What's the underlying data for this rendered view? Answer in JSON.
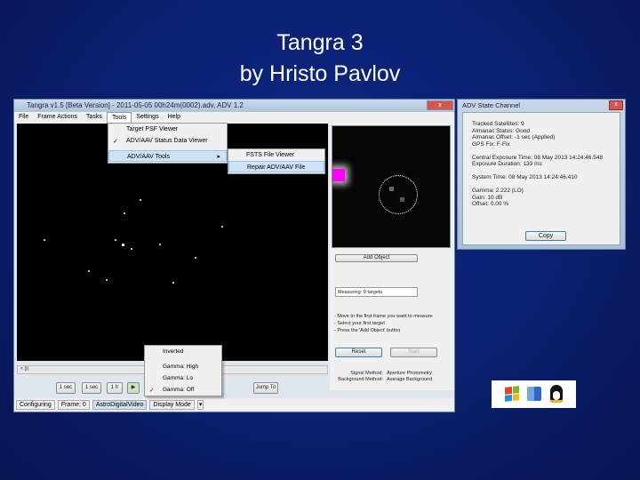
{
  "slide": {
    "title_line1": "Tangra 3",
    "title_line2": "by Hristo Pavlov"
  },
  "window": {
    "title": "Tangra v1.5 [Beta Version] - 2011-05-05 00h24m(0002).adv, ADV 1.2",
    "menu": [
      "File",
      "Frame Actions",
      "Tasks",
      "Tools",
      "Settings",
      "Help"
    ],
    "tools_menu": [
      {
        "label": "Target PSF Viewer",
        "checked": false
      },
      {
        "label": "ADV/AAV Status Data Viewer",
        "checked": true
      },
      {
        "label": "ADV/AAV Tools",
        "submenu": true
      }
    ],
    "submenu": [
      "FSTS File Viewer",
      "Repair ADV/AAV File"
    ],
    "right_panel": {
      "add_object": "Add Object",
      "measuring_label": "Measuring:",
      "measuring_value": "0 targets",
      "instructions": [
        "- Move to the first frame you want to measure",
        "- Select your first target",
        "- Press the 'Add Object' button"
      ],
      "reset": "Reset",
      "start": "Start",
      "signal_label": "Signal Method:",
      "signal_value": "Aperture Photometry",
      "bg_label": "Background Method:",
      "bg_value": "Average Background"
    },
    "display_menu": [
      {
        "label": "Inverted",
        "checked": false
      },
      {
        "label": "Gamma: High",
        "checked": false
      },
      {
        "label": "Gamma: Lo",
        "checked": false
      },
      {
        "label": "Gamma: Off",
        "checked": true
      }
    ],
    "nav_buttons": [
      "1 sec",
      "1 sec",
      "1 fr",
      "Jump To"
    ],
    "scroll_label": "< |||",
    "status": [
      "Configuring",
      "Frame: 0",
      "AstroDigitalVideo",
      "Display Mode"
    ]
  },
  "dialog": {
    "title": "ADV State Channel",
    "close": "x",
    "lines": [
      "Tracked Satellites: 9",
      "Almanac Status: Good",
      "Almanac Offset: -1 sec (Applied)",
      "GPS Fix: F-Fix",
      "",
      "Central Exposure Time: 08 May 2013 14:24:46.548",
      "Exposure Duration: 133 ms",
      "",
      "System Time: 08 May 2013 14:24:46.410",
      "",
      "Gamma: 2.222 (LO)",
      "Gain: 10 dB",
      "Offset: 0.00 %"
    ],
    "copy": "Copy"
  },
  "logos": [
    "windows-logo",
    "mac-finder-logo",
    "linux-tux-logo"
  ]
}
